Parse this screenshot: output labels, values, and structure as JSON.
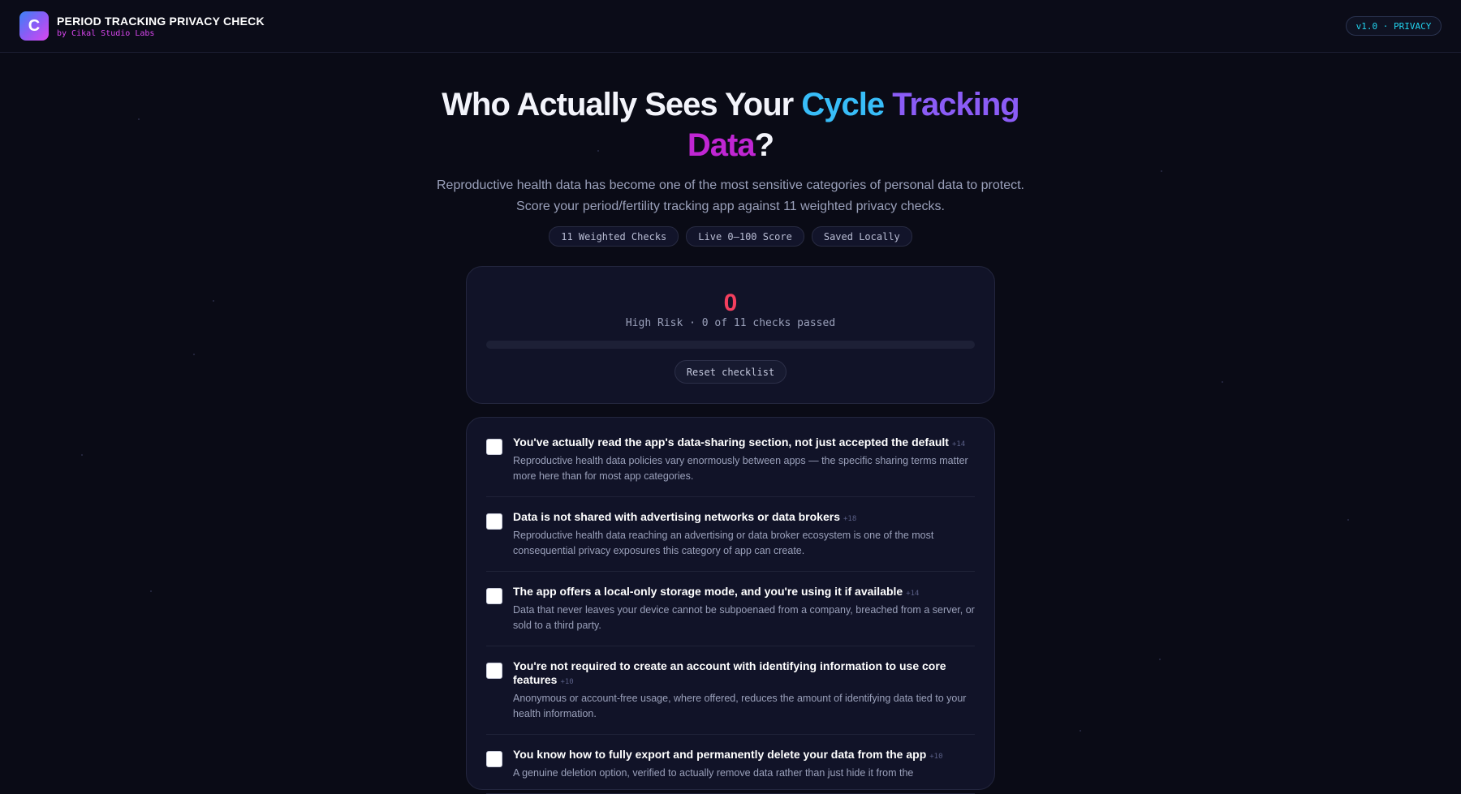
{
  "header": {
    "logo_letter": "C",
    "title": "PERIOD TRACKING PRIVACY CHECK",
    "subtitle": "by Cikal Studio Labs",
    "version": "v1.0 · PRIVACY"
  },
  "hero": {
    "title_part1": "Who Actually Sees Your ",
    "title_cyan": "Cycle ",
    "title_violet": "Tracking",
    "title_magenta": "Data",
    "title_end": "?",
    "subtitle": "Reproductive health data has become one of the most sensitive categories of personal data to protect. Score your period/fertility tracking app against 11 weighted privacy checks.",
    "tags": [
      "11 Weighted Checks",
      "Live 0–100 Score",
      "Saved Locally"
    ]
  },
  "score": {
    "value": "0",
    "status": "High Risk · 0 of 11 checks passed",
    "progress_fraction": 0,
    "reset_label": "Reset checklist"
  },
  "checklist": {
    "items": [
      {
        "title": "You've actually read the app's data-sharing section, not just accepted the default",
        "weight": "+14",
        "desc": "Reproductive health data policies vary enormously between apps — the specific sharing terms matter more here than for most app categories.",
        "checked": false
      },
      {
        "title": "Data is not shared with advertising networks or data brokers",
        "weight": "+18",
        "desc": "Reproductive health data reaching an advertising or data broker ecosystem is one of the most consequential privacy exposures this category of app can create.",
        "checked": false
      },
      {
        "title": "The app offers a local-only storage mode, and you're using it if available",
        "weight": "+14",
        "desc": "Data that never leaves your device cannot be subpoenaed from a company, breached from a server, or sold to a third party.",
        "checked": false
      },
      {
        "title": "You're not required to create an account with identifying information to use core features",
        "weight": "+10",
        "desc": "Anonymous or account-free usage, where offered, reduces the amount of identifying data tied to your health information.",
        "checked": false
      },
      {
        "title": "You know how to fully export and permanently delete your data from the app",
        "weight": "+10",
        "desc": "A genuine deletion option, verified to actually remove data rather than just hide it from the",
        "checked": false
      }
    ]
  },
  "colors": {
    "background": "#0a0b16",
    "card": "#111328",
    "risk": "#f43f5e",
    "accent_cyan": "#38bdf8",
    "accent_violet": "#8b5cf6",
    "accent_magenta": "#d946ef"
  }
}
